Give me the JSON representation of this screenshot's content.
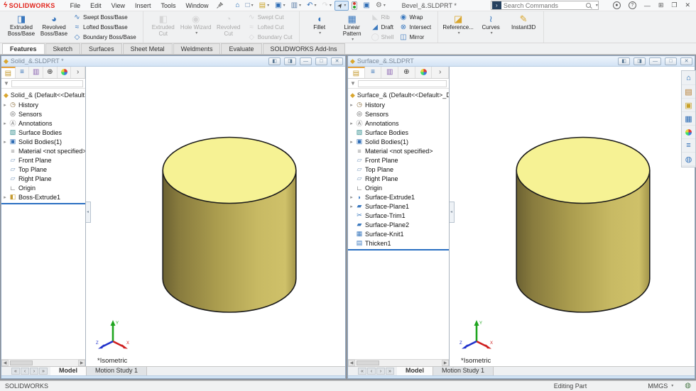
{
  "app": {
    "brand": "SOLIDWORKS",
    "title": "Bevel_&.SLDPRT *"
  },
  "menubar": {
    "menus": [
      "File",
      "Edit",
      "View",
      "Insert",
      "Tools",
      "Window"
    ],
    "quick_access": [
      {
        "name": "home-button",
        "glyph": "⌂",
        "color": "#1d66b0",
        "dropdown": false
      },
      {
        "name": "new-document-button",
        "glyph": "□",
        "color": "#5a7ca6",
        "dropdown": true
      },
      {
        "name": "open-document-button",
        "glyph": "▤",
        "color": "#c9a227",
        "dropdown": true
      },
      {
        "name": "save-button",
        "glyph": "▣",
        "color": "#2d6cb5",
        "dropdown": true
      },
      {
        "name": "print-button",
        "glyph": "▥",
        "color": "#5a7ca6",
        "dropdown": true
      },
      {
        "name": "undo-button",
        "glyph": "↶",
        "color": "#2d6cb5",
        "dropdown": true
      },
      {
        "name": "redo-button",
        "glyph": "↷",
        "color": "#bcbcbc",
        "dropdown": true,
        "disabled": true
      },
      {
        "name": "select-button",
        "glyph": "➤",
        "color": "#444444",
        "dropdown": true,
        "pressed": true,
        "rotate": true
      },
      {
        "name": "rebuild-button",
        "special": "rebuild",
        "dropdown": false
      },
      {
        "name": "file-properties-button",
        "glyph": "▣",
        "color": "#2d6cb5",
        "dropdown": false
      },
      {
        "name": "options-button",
        "glyph": "⚙",
        "color": "#777777",
        "dropdown": true
      }
    ],
    "search": {
      "placeholder": "Search Commands",
      "tile_glyph": "›"
    },
    "window_controls": [
      {
        "name": "login-button",
        "glyph": "●",
        "circled": true
      },
      {
        "name": "help-button",
        "glyph": "?",
        "circled": true
      },
      {
        "name": "minimize-button",
        "glyph": "—"
      },
      {
        "name": "layout-button",
        "glyph": "⊞"
      },
      {
        "name": "restore-button",
        "glyph": "❐"
      },
      {
        "name": "close-button",
        "glyph": "✕"
      }
    ]
  },
  "command_manager": {
    "tabs": [
      "Features",
      "Sketch",
      "Surfaces",
      "Sheet Metal",
      "Weldments",
      "Evaluate",
      "SOLIDWORKS Add-Ins"
    ],
    "active_tab": "Features",
    "groups": [
      {
        "big": [
          {
            "label": "Extruded Boss/Base",
            "icon": "extruded-boss",
            "enabled": true
          },
          {
            "label": "Revolved Boss/Base",
            "icon": "revolved-boss",
            "enabled": true
          }
        ],
        "cols": [
          [
            {
              "label": "Swept Boss/Base",
              "icon": "swept-boss",
              "enabled": true
            },
            {
              "label": "Lofted Boss/Base",
              "icon": "lofted-boss",
              "enabled": true
            },
            {
              "label": "Boundary Boss/Base",
              "icon": "boundary-boss",
              "enabled": true
            }
          ]
        ]
      },
      {
        "big": [
          {
            "label": "Extruded Cut",
            "icon": "extruded-cut",
            "enabled": false
          },
          {
            "label": "Hole Wizard",
            "icon": "hole-wizard",
            "enabled": false,
            "dropdown": true
          },
          {
            "label": "Revolved Cut",
            "icon": "revolved-cut",
            "enabled": false
          }
        ],
        "cols": [
          [
            {
              "label": "Swept Cut",
              "icon": "swept-cut",
              "enabled": false
            },
            {
              "label": "Lofted Cut",
              "icon": "lofted-cut",
              "enabled": false
            },
            {
              "label": "Boundary Cut",
              "icon": "boundary-cut",
              "enabled": false
            }
          ]
        ]
      },
      {
        "big": [
          {
            "label": "Fillet",
            "icon": "fillet",
            "enabled": true,
            "dropdown": true
          },
          {
            "label": "Linear Pattern",
            "icon": "linear-pattern",
            "enabled": true,
            "dropdown": true
          }
        ],
        "cols": [
          [
            {
              "label": "Rib",
              "icon": "rib",
              "enabled": false
            },
            {
              "label": "Draft",
              "icon": "draft",
              "enabled": true
            },
            {
              "label": "Shell",
              "icon": "shell",
              "enabled": false
            }
          ],
          [
            {
              "label": "Wrap",
              "icon": "wrap",
              "enabled": true
            },
            {
              "label": "Intersect",
              "icon": "intersect",
              "enabled": true
            },
            {
              "label": "Mirror",
              "icon": "mirror",
              "enabled": true
            }
          ]
        ]
      },
      {
        "big": [
          {
            "label": "Reference...",
            "icon": "reference-geometry",
            "enabled": true,
            "dropdown": true
          },
          {
            "label": "Curves",
            "icon": "curves",
            "enabled": true,
            "dropdown": true
          },
          {
            "label": "Instant3D",
            "icon": "instant3d",
            "enabled": true
          }
        ]
      }
    ]
  },
  "cm_icons": {
    "extruded-boss": {
      "glyph": "◨",
      "color": "#3a78be"
    },
    "revolved-boss": {
      "glyph": "◕",
      "color": "#3a78be"
    },
    "swept-boss": {
      "glyph": "∿",
      "color": "#3a78be"
    },
    "lofted-boss": {
      "glyph": "≈",
      "color": "#3a78be"
    },
    "boundary-boss": {
      "glyph": "◇",
      "color": "#3a78be"
    },
    "extruded-cut": {
      "glyph": "◧",
      "color": "#b5b5b5"
    },
    "hole-wizard": {
      "glyph": "◉",
      "color": "#b5b5b5"
    },
    "revolved-cut": {
      "glyph": "◔",
      "color": "#b5b5b5"
    },
    "swept-cut": {
      "glyph": "∿",
      "color": "#b5b5b5"
    },
    "lofted-cut": {
      "glyph": "≈",
      "color": "#b5b5b5"
    },
    "boundary-cut": {
      "glyph": "◇",
      "color": "#b5b5b5"
    },
    "fillet": {
      "glyph": "◖",
      "color": "#3a78be"
    },
    "linear-pattern": {
      "glyph": "▦",
      "color": "#3a78be"
    },
    "rib": {
      "glyph": "◣",
      "color": "#bbbbbb"
    },
    "draft": {
      "glyph": "◢",
      "color": "#3a78be"
    },
    "shell": {
      "glyph": "◯",
      "color": "#bbbbbb"
    },
    "wrap": {
      "glyph": "◉",
      "color": "#3a78be"
    },
    "intersect": {
      "glyph": "⊗",
      "color": "#3a78be"
    },
    "mirror": {
      "glyph": "◫",
      "color": "#3a78be"
    },
    "reference-geometry": {
      "glyph": "◪",
      "color": "#d9a62e"
    },
    "curves": {
      "glyph": "≀",
      "color": "#3a78be"
    },
    "instant3d": {
      "glyph": "✎",
      "color": "#d9a62e"
    }
  },
  "feature_panel": {
    "tabs": [
      {
        "name": "featuremanager-tab",
        "glyph": "▤",
        "color": "#c59a2e",
        "active": true
      },
      {
        "name": "propertymanager-tab",
        "glyph": "≡",
        "color": "#2d6cb5"
      },
      {
        "name": "configurationmanager-tab",
        "glyph": "▥",
        "color": "#8860b0"
      },
      {
        "name": "dimxpertmanager-tab",
        "glyph": "⊕",
        "color": "#333333"
      },
      {
        "name": "displaymanager-tab",
        "glyph": "pie"
      },
      {
        "name": "more-tabs-button",
        "glyph": "›",
        "color": "#555555"
      }
    ]
  },
  "tree_icons": {
    "history": {
      "glyph": "◷",
      "color": "#8a6d3b"
    },
    "sensors": {
      "glyph": "◎",
      "color": "#555555"
    },
    "annotations": {
      "glyph": "Ⓐ",
      "color": "#777777"
    },
    "surface-bodies": {
      "glyph": "▧",
      "color": "#2e8b8b"
    },
    "solid-bodies": {
      "glyph": "▣",
      "color": "#2d6cb5"
    },
    "material": {
      "glyph": "≡",
      "color": "#888888"
    },
    "plane": {
      "glyph": "▱",
      "color": "#7d9cc0"
    },
    "origin": {
      "glyph": "∟",
      "color": "#333333"
    },
    "boss-extrude": {
      "glyph": "◧",
      "color": "#c59a2e"
    },
    "surface-extrude": {
      "glyph": "◗",
      "color": "#3a78be"
    },
    "surface-plane": {
      "glyph": "▰",
      "color": "#3a78be"
    },
    "surface-trim": {
      "glyph": "✂",
      "color": "#3a78be"
    },
    "surface-knit": {
      "glyph": "▦",
      "color": "#3a78be"
    },
    "thicken": {
      "glyph": "▤",
      "color": "#3a78be"
    }
  },
  "part_icon": {
    "glyph": "◆",
    "color": "#d9a62e"
  },
  "child_window_controls": [
    {
      "name": "cascade-button",
      "glyph": "◧"
    },
    {
      "name": "tile-button",
      "glyph": "◨"
    },
    {
      "name": "minimize-button",
      "glyph": "—"
    },
    {
      "name": "maximize-button",
      "glyph": "□"
    },
    {
      "name": "close-button",
      "glyph": "✕"
    }
  ],
  "doc_nav": [
    "«",
    "‹",
    "›",
    "»"
  ],
  "documents": [
    {
      "title": "Solid_&.SLDPRT *",
      "root": "Solid_& (Default<<Default>_",
      "tree": [
        {
          "icon": "history",
          "label": "History",
          "expand": true
        },
        {
          "icon": "sensors",
          "label": "Sensors"
        },
        {
          "icon": "annotations",
          "label": "Annotations",
          "expand": true
        },
        {
          "icon": "surface-bodies",
          "label": "Surface Bodies"
        },
        {
          "icon": "solid-bodies",
          "label": "Solid Bodies(1)",
          "expand": true
        },
        {
          "icon": "material",
          "label": "Material <not specified>"
        },
        {
          "icon": "plane",
          "label": "Front Plane"
        },
        {
          "icon": "plane",
          "label": "Top Plane"
        },
        {
          "icon": "plane",
          "label": "Right Plane"
        },
        {
          "icon": "origin",
          "label": "Origin"
        },
        {
          "icon": "boss-extrude",
          "label": "Boss-Extrude1",
          "expand": true
        }
      ],
      "view_label": "*Isometric",
      "doc_tabs": [
        "Model",
        "Motion Study 1"
      ],
      "active_doc_tab": "Model"
    },
    {
      "title": "Surface_&.SLDPRT",
      "root": "Surface_& (Default<<Default>_Disp",
      "tree": [
        {
          "icon": "history",
          "label": "History",
          "expand": true
        },
        {
          "icon": "sensors",
          "label": "Sensors"
        },
        {
          "icon": "annotations",
          "label": "Annotations",
          "expand": true
        },
        {
          "icon": "surface-bodies",
          "label": "Surface Bodies"
        },
        {
          "icon": "solid-bodies",
          "label": "Solid Bodies(1)",
          "expand": true
        },
        {
          "icon": "material",
          "label": "Material <not specified>"
        },
        {
          "icon": "plane",
          "label": "Front Plane"
        },
        {
          "icon": "plane",
          "label": "Top Plane"
        },
        {
          "icon": "plane",
          "label": "Right Plane"
        },
        {
          "icon": "origin",
          "label": "Origin"
        },
        {
          "icon": "surface-extrude",
          "label": "Surface-Extrude1",
          "expand": true
        },
        {
          "icon": "surface-plane",
          "label": "Surface-Plane1",
          "expand": true
        },
        {
          "icon": "surface-trim",
          "label": "Surface-Trim1"
        },
        {
          "icon": "surface-plane",
          "label": "Surface-Plane2"
        },
        {
          "icon": "surface-knit",
          "label": "Surface-Knit1"
        },
        {
          "icon": "thicken",
          "label": "Thicken1"
        }
      ],
      "view_label": "*Isometric",
      "doc_tabs": [
        "Model",
        "Motion Study 1"
      ],
      "active_doc_tab": "Model"
    }
  ],
  "task_pane": [
    {
      "name": "solidworks-resources-tab",
      "glyph": "⌂",
      "color": "#1d66b0"
    },
    {
      "name": "design-library-tab",
      "glyph": "▤",
      "color": "#b5792a"
    },
    {
      "name": "file-explorer-tab",
      "glyph": "▣",
      "color": "#c9a227"
    },
    {
      "name": "view-palette-tab",
      "glyph": "▦",
      "color": "#2d6cb5"
    },
    {
      "name": "appearances-tab",
      "glyph": "pie"
    },
    {
      "name": "custom-properties-tab",
      "glyph": "≡",
      "color": "#2d6cb5"
    },
    {
      "name": "solidworks-forum-tab",
      "glyph": "◍",
      "color": "#3a78be"
    }
  ],
  "triad": {
    "x": "X",
    "y": "Y",
    "z": "Z"
  },
  "status": {
    "left": "SOLIDWORKS",
    "editing": "Editing Part",
    "units": "MMGS"
  },
  "colors": {
    "brand_red": "#e2231a",
    "accent_blue": "#2d6cb5",
    "titlebar_blue": "#d3e3f5",
    "cylinder_top": "#f6f294",
    "cylinder_side_dark": "#6b6132",
    "cylinder_side_light": "#cdbf68",
    "rollback_bar": "#2a6fc2"
  }
}
